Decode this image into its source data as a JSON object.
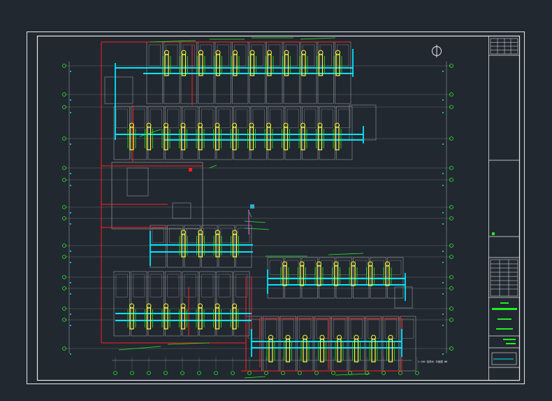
{
  "viewport": {
    "background": "#212830"
  },
  "colors": {
    "frame": "#e8e8e8",
    "grid_line": "#7c7c7c",
    "wall": "#9a9a9a",
    "pipe": "#00e5ff",
    "fixture": "#ffff33",
    "annotation": "#22ee22",
    "boundary": "#ff2020",
    "magenta": "#ff44ff"
  },
  "title_block": {
    "revision_table": "revision-table",
    "legend_marker": "green-marker"
  },
  "north_symbol": "north-arrow-icon",
  "note_text": "1:100  给排水  平面图  WB"
}
